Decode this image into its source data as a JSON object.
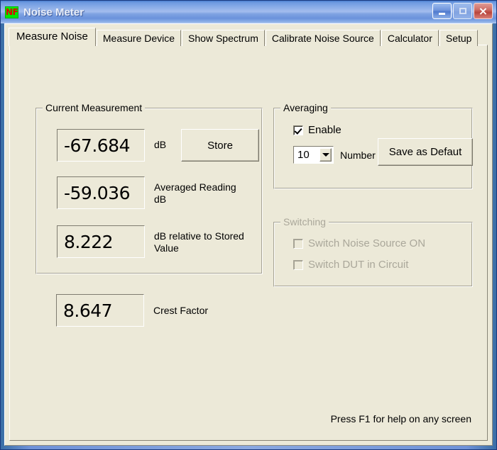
{
  "window": {
    "title": "Noise Meter",
    "icon_label": "NF",
    "controls": {
      "minimize": "minimize-button",
      "maximize": "maximize-button",
      "close": "×"
    }
  },
  "tabs": [
    {
      "label": "Measure Noise",
      "active": true
    },
    {
      "label": "Measure Device",
      "active": false
    },
    {
      "label": "Show Spectrum",
      "active": false
    },
    {
      "label": "Calibrate Noise Source",
      "active": false
    },
    {
      "label": "Calculator",
      "active": false
    },
    {
      "label": "Setup",
      "active": false
    }
  ],
  "current_measurement": {
    "title": "Current Measurement",
    "readouts": [
      {
        "value": "-67.684",
        "label": "dB"
      },
      {
        "value": "-59.036",
        "label": "Averaged Reading\ndB"
      },
      {
        "value": "8.222",
        "label": "dB relative to Stored\nValue"
      },
      {
        "value": "8.647",
        "label": "Crest Factor"
      }
    ],
    "store_button": "Store"
  },
  "averaging": {
    "title": "Averaging",
    "enable_label": "Enable",
    "enable_checked": true,
    "number_value": "10",
    "number_label": "Number",
    "save_button": "Save as Defaut"
  },
  "switching": {
    "title": "Switching",
    "disabled": true,
    "items": [
      {
        "label": "Switch Noise Source ON",
        "checked": false
      },
      {
        "label": "Switch DUT in Circuit",
        "checked": false
      }
    ]
  },
  "footer": {
    "help_text": "Press F1 for help on any screen"
  },
  "colors": {
    "face": "#ece9d8",
    "title_bar_blue": "#6f92d8",
    "close_red": "#b8453c",
    "icon_green": "#00e800",
    "icon_red": "#e00000"
  }
}
